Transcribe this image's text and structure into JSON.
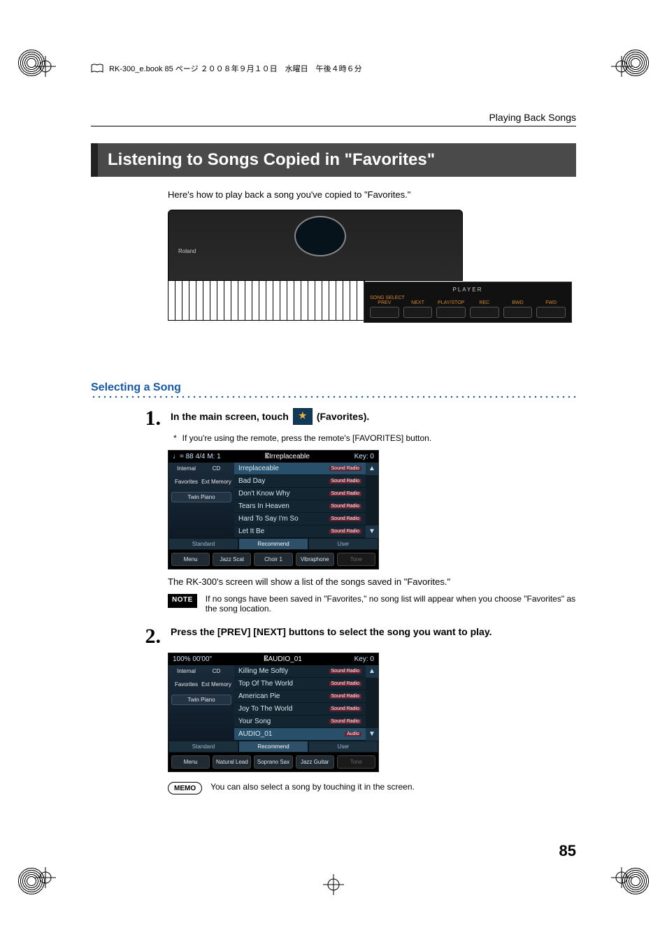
{
  "print_header": "RK-300_e.book  85 ページ  ２００８年９月１０日　水曜日　午後４時６分",
  "running_head": "Playing Back Songs",
  "section_title": "Listening to Songs Copied in \"Favorites\"",
  "intro": "Here's how to play back a song you've copied to \"Favorites.\"",
  "keyboard": {
    "brand": "Roland",
    "panel_title": "PLAYER",
    "panel_sub": "SONG SELECT",
    "labels": [
      "PREV",
      "NEXT",
      "PLAY/STOP",
      "REC",
      "BWD",
      "FWD"
    ]
  },
  "sub_heading": "Selecting a Song",
  "step1": {
    "num": "1.",
    "pre": "In the main screen, touch",
    "post": "(Favorites).",
    "aster": "*",
    "aster_text": "If you're using the remote, press the remote's [FAVORITES] button."
  },
  "shot1": {
    "top_left": "♩= 88   4/4   M:   1",
    "top_mid_prefix": "𝄡",
    "top_mid": "Irreplaceable",
    "top_right": "Key: 0",
    "left_col": {
      "a1": "Internal",
      "a2": "CD",
      "b1": "Favorites",
      "b2": "Ext Memory",
      "twin": "Twin Piano"
    },
    "songs": [
      "Irreplaceable",
      "Bad Day",
      "Don't Know Why",
      "Tears In Heaven",
      "Hard To Say I'm So",
      "Let It Be"
    ],
    "tag": "Sound Radio",
    "tabs": [
      "Standard",
      "Recommend",
      "User"
    ],
    "bottom": [
      "Menu",
      "Jazz Scat",
      "Choir 1",
      "Vibraphone",
      "Tone"
    ]
  },
  "after_shot1": "The RK-300's screen will show a list of the songs saved in \"Favorites.\"",
  "note_label": "NOTE",
  "note_text": "If no songs have been saved in \"Favorites,\" no song list will appear when you choose \"Favorites\" as the song location.",
  "step2": {
    "num": "2.",
    "text": "Press the [PREV] [NEXT] buttons to select the song you want to play."
  },
  "shot2": {
    "top_left": "100%      00'00\"",
    "top_mid_prefix": "𝄡",
    "top_mid": "AUDIO_01",
    "top_right": "Key: 0",
    "left_col": {
      "a1": "Internal",
      "a2": "CD",
      "b1": "Favorites",
      "b2": "Ext Memory",
      "twin": "Twin Piano"
    },
    "songs": [
      "Killing Me Softly",
      "Top Of The World",
      "American Pie",
      "Joy To The World",
      "Your Song",
      "AUDIO_01"
    ],
    "tag": "Sound Radio",
    "tag_last": "Audio",
    "tabs": [
      "Standard",
      "Recommend",
      "User"
    ],
    "bottom": [
      "Menu",
      "Natural Lead",
      "Soprano Sax",
      "Jazz Guitar",
      "Tone"
    ]
  },
  "memo_label": "MEMO",
  "memo_text": "You can also select a song by touching it in the screen.",
  "page_number": "85"
}
